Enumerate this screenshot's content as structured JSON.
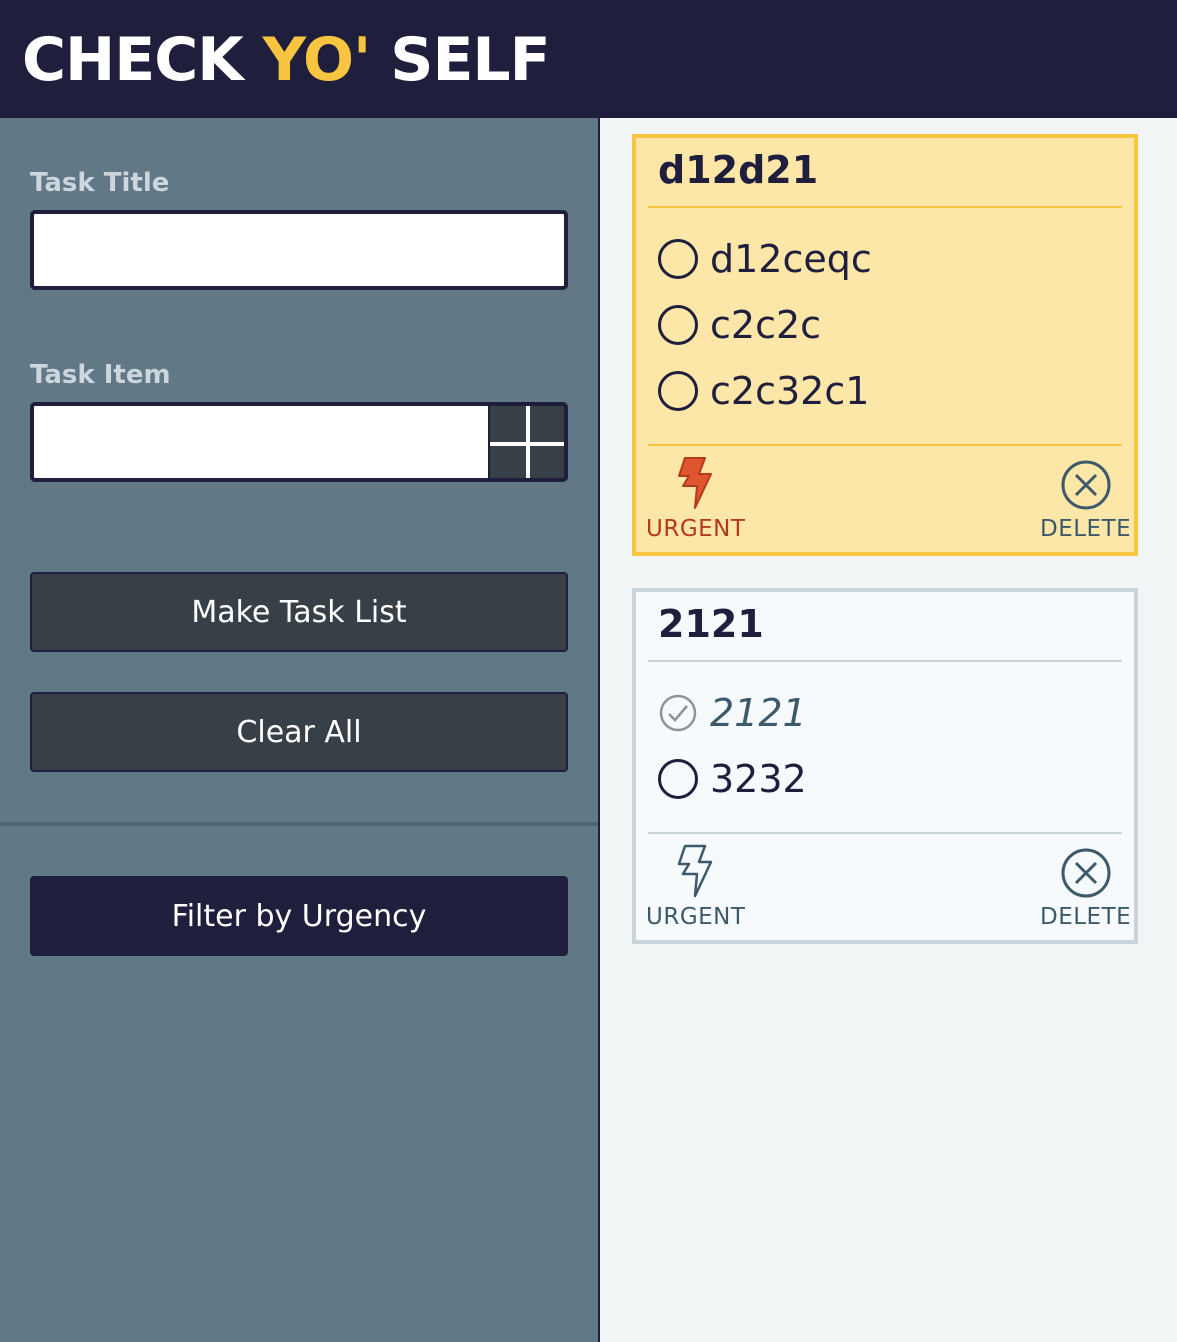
{
  "app": {
    "title_part1": "CHECK ",
    "title_part2": "YO'",
    "title_part3": " SELF",
    "accent_color": "#f7c540",
    "header_color": "#1f1f3d"
  },
  "form": {
    "task_title_label": "Task Title",
    "task_title_value": "",
    "task_item_label": "Task Item",
    "task_item_value": "",
    "add_icon": "plus-icon",
    "make_list_label": "Make Task List",
    "clear_all_label": "Clear All",
    "filter_label": "Filter by Urgency"
  },
  "cards": [
    {
      "title": "d12d21",
      "urgent": true,
      "items": [
        {
          "text": "d12ceqc",
          "checked": false
        },
        {
          "text": "c2c2c",
          "checked": false
        },
        {
          "text": "c2c32c1",
          "checked": false
        }
      ],
      "urgent_label": "URGENT",
      "delete_label": "DELETE"
    },
    {
      "title": "2121",
      "urgent": false,
      "items": [
        {
          "text": "2121",
          "checked": true
        },
        {
          "text": "3232",
          "checked": false
        }
      ],
      "urgent_label": "URGENT",
      "delete_label": "DELETE"
    }
  ],
  "colors": {
    "urgent_card_bg": "#fce6a8",
    "urgent_text": "#b5391b",
    "urgent_bolt": "#e0552d",
    "normal_text": "#3d5a6b"
  }
}
